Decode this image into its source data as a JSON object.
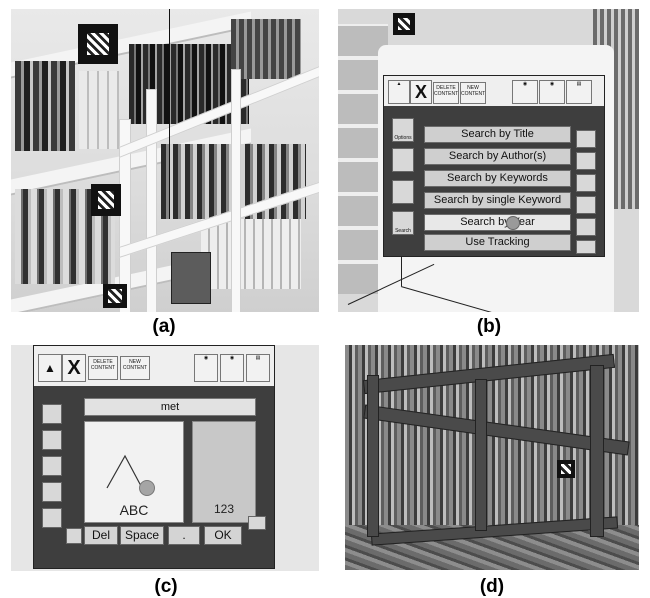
{
  "captions": {
    "a": "(a)",
    "b": "(b)",
    "c": "(c)",
    "d": "(d)"
  },
  "panel_b": {
    "toolbar": {
      "delete_content": "DELETE CONTENT",
      "new_content": "NEW CONTENT",
      "btn_right_1": "",
      "btn_right_2": "",
      "btn_right_3": ""
    },
    "menu_items": [
      "Search by Title",
      "Search by Author(s)",
      "Search by Keywords",
      "Search by single Keyword",
      "Search by Year",
      "Use Tracking"
    ],
    "left_icons": [
      "Options",
      "",
      "",
      "Search"
    ]
  },
  "panel_c": {
    "toolbar": {
      "delete_content": "DELETE CONTENT",
      "new_content": "NEW CONTENT"
    },
    "input_value": "met",
    "letters_pad_label": "ABC",
    "digits_pad_label": "123",
    "keys": {
      "del": "Del",
      "space": "Space",
      "dot": ".",
      "ok": "OK"
    }
  }
}
